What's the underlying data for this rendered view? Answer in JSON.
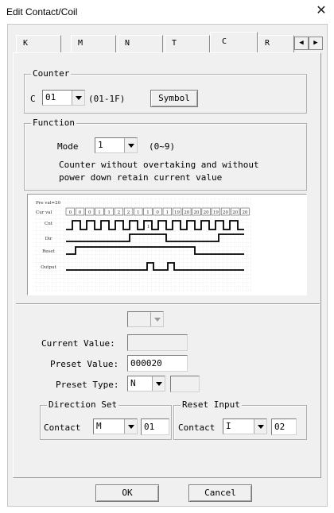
{
  "window": {
    "title": "Edit Contact/Coil",
    "close_glyph": "✕"
  },
  "tabs": [
    {
      "label": "K",
      "active": false
    },
    {
      "label": "M",
      "active": false
    },
    {
      "label": "N",
      "active": false
    },
    {
      "label": "T",
      "active": false
    },
    {
      "label": "C",
      "active": true
    },
    {
      "label": "R",
      "active": false
    }
  ],
  "tab_scroll": {
    "left": "◀",
    "right": "▶"
  },
  "counter": {
    "group_title": "Counter",
    "prefix": "C",
    "number": "01",
    "range": "(01-1F)",
    "symbol_button": "Symbol"
  },
  "function": {
    "group_title": "Function",
    "mode_label": "Mode",
    "mode_value": "1",
    "mode_range": "(0~9)",
    "description_line1": "Counter without overtaking and without",
    "description_line2": "power down retain current value"
  },
  "diagram": {
    "preset_label": "Pre val=20",
    "cur_label": "Cur val",
    "cur_values": [
      "0",
      "0",
      "0",
      "1",
      "1",
      "2",
      "2",
      "1",
      "1",
      "0",
      "1",
      "19",
      "20",
      "20",
      "20",
      "19",
      "20",
      "20",
      "20"
    ],
    "signals": [
      "Cnt",
      "Dir",
      "Reset",
      "Output"
    ],
    "cnt_overlay": "1"
  },
  "values": {
    "unnamed_combo": "",
    "current_value_label": "Current Value:",
    "current_value": "",
    "preset_value_label": "Preset Value:",
    "preset_value": "000020",
    "preset_type_label": "Preset Type:",
    "preset_type": "N",
    "preset_type_extra": ""
  },
  "direction": {
    "group_title": "Direction Set",
    "contact_label": "Contact",
    "contact_type": "M",
    "contact_number": "01"
  },
  "reset": {
    "group_title": "Reset Input",
    "contact_label": "Contact",
    "contact_type": "I",
    "contact_number": "02"
  },
  "buttons": {
    "ok": "OK",
    "cancel": "Cancel"
  }
}
